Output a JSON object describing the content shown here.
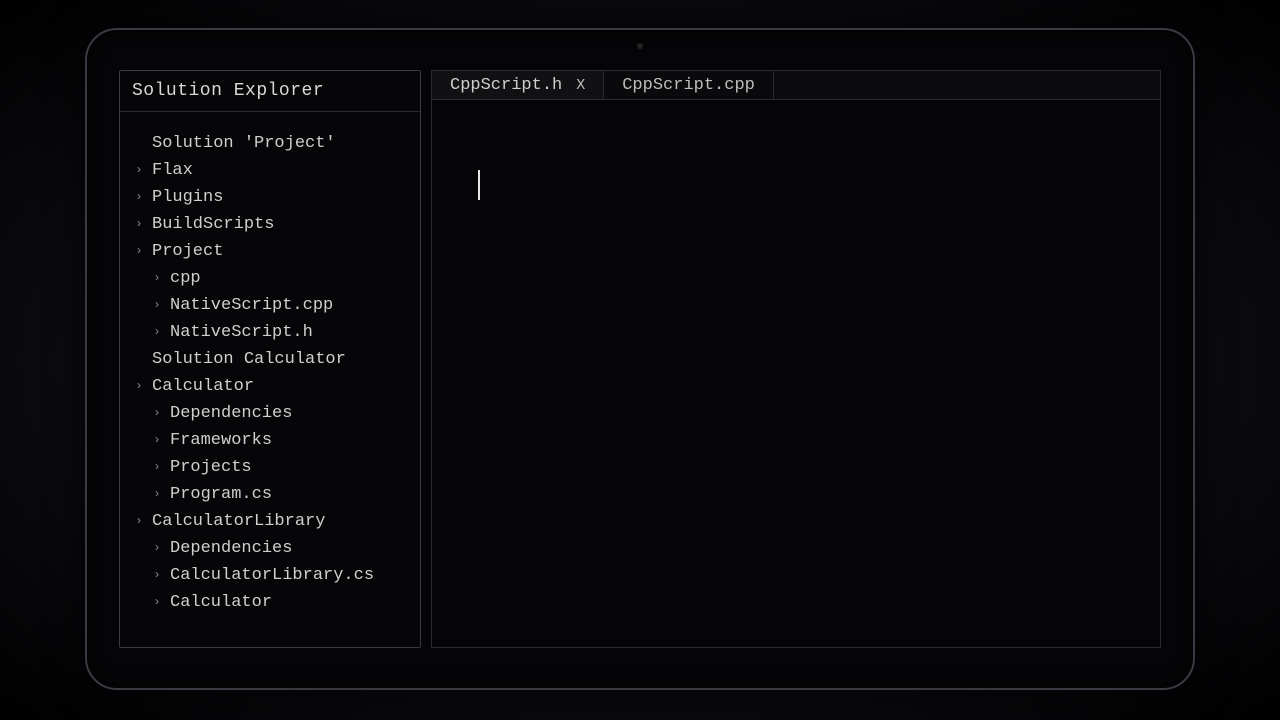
{
  "sidebar": {
    "title": "Solution Explorer",
    "tree": [
      {
        "label": "Solution 'Project'",
        "indent": 0,
        "chevron": false,
        "interactable": false
      },
      {
        "label": "Flax",
        "indent": 1,
        "chevron": true,
        "interactable": true
      },
      {
        "label": "Plugins",
        "indent": 1,
        "chevron": true,
        "interactable": true
      },
      {
        "label": "BuildScripts",
        "indent": 1,
        "chevron": true,
        "interactable": true
      },
      {
        "label": "Project",
        "indent": 1,
        "chevron": true,
        "interactable": true
      },
      {
        "label": "cpp",
        "indent": 2,
        "chevron": true,
        "interactable": true
      },
      {
        "label": "NativeScript.cpp",
        "indent": 2,
        "chevron": true,
        "interactable": true
      },
      {
        "label": "NativeScript.h",
        "indent": 2,
        "chevron": true,
        "interactable": true
      },
      {
        "label": "Solution Calculator",
        "indent": 0,
        "chevron": false,
        "interactable": false
      },
      {
        "label": "Calculator",
        "indent": 1,
        "chevron": true,
        "interactable": true
      },
      {
        "label": "Dependencies",
        "indent": 2,
        "chevron": true,
        "interactable": true
      },
      {
        "label": "Frameworks",
        "indent": 2,
        "chevron": true,
        "interactable": true
      },
      {
        "label": "Projects",
        "indent": 2,
        "chevron": true,
        "interactable": true
      },
      {
        "label": "Program.cs",
        "indent": 2,
        "chevron": true,
        "interactable": true
      },
      {
        "label": "CalculatorLibrary",
        "indent": 1,
        "chevron": true,
        "interactable": true
      },
      {
        "label": "Dependencies",
        "indent": 2,
        "chevron": true,
        "interactable": true
      },
      {
        "label": "CalculatorLibrary.cs",
        "indent": 2,
        "chevron": true,
        "interactable": true
      },
      {
        "label": "Calculator",
        "indent": 2,
        "chevron": true,
        "interactable": true
      }
    ]
  },
  "tabs": [
    {
      "label": "CppScript.h",
      "active": true,
      "closeGlyph": "X"
    },
    {
      "label": "CppScript.cpp",
      "active": false,
      "closeGlyph": ""
    }
  ]
}
